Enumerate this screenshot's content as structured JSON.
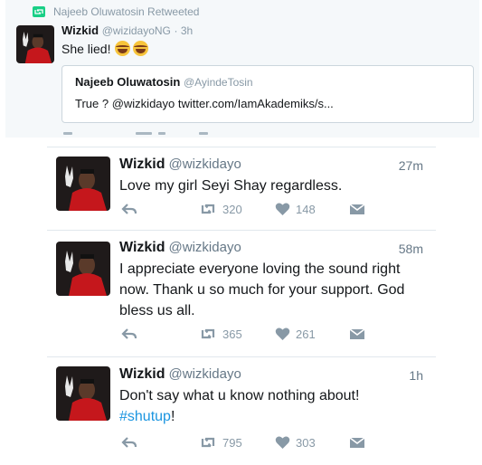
{
  "retweet_card": {
    "retweeted_by": "Najeeb Oluwatosin Retweeted",
    "author_name": "Wizkid",
    "author_handle": "@wizidayoNG",
    "time": "3h",
    "text": "She lied!",
    "emojis": [
      "face-with-tears-of-joy",
      "face-with-tears-of-joy"
    ],
    "quote": {
      "name": "Najeeb Oluwatosin",
      "handle": "@AyindeTosin",
      "text": "True ? @wizkidayo twitter.com/IamAkademiks/s..."
    }
  },
  "tweets": [
    {
      "name": "Wizkid",
      "handle": "@wizkidayo",
      "time": "27m",
      "text": "Love my girl Seyi Shay regardless.",
      "retweets": "320",
      "likes": "148"
    },
    {
      "name": "Wizkid",
      "handle": "@wizkidayo",
      "time": "58m",
      "text": "I appreciate everyone loving the sound right now. Thank u so much for your support. God bless us all.",
      "retweets": "365",
      "likes": "261"
    },
    {
      "name": "Wizkid",
      "handle": "@wizkidayo",
      "time": "1h",
      "text": "Don't say what u know nothing about!",
      "hashtag": "#shutup",
      "suffix": "!",
      "retweets": "795",
      "likes": "303"
    }
  ],
  "icons": {
    "reply": "reply-icon",
    "retweet": "retweet-icon",
    "like": "heart-icon",
    "dm": "direct-message-icon"
  },
  "colors": {
    "retweet_badge": "#19cf86",
    "hashtag": "#1b95e0",
    "muted": "#8899a6"
  }
}
